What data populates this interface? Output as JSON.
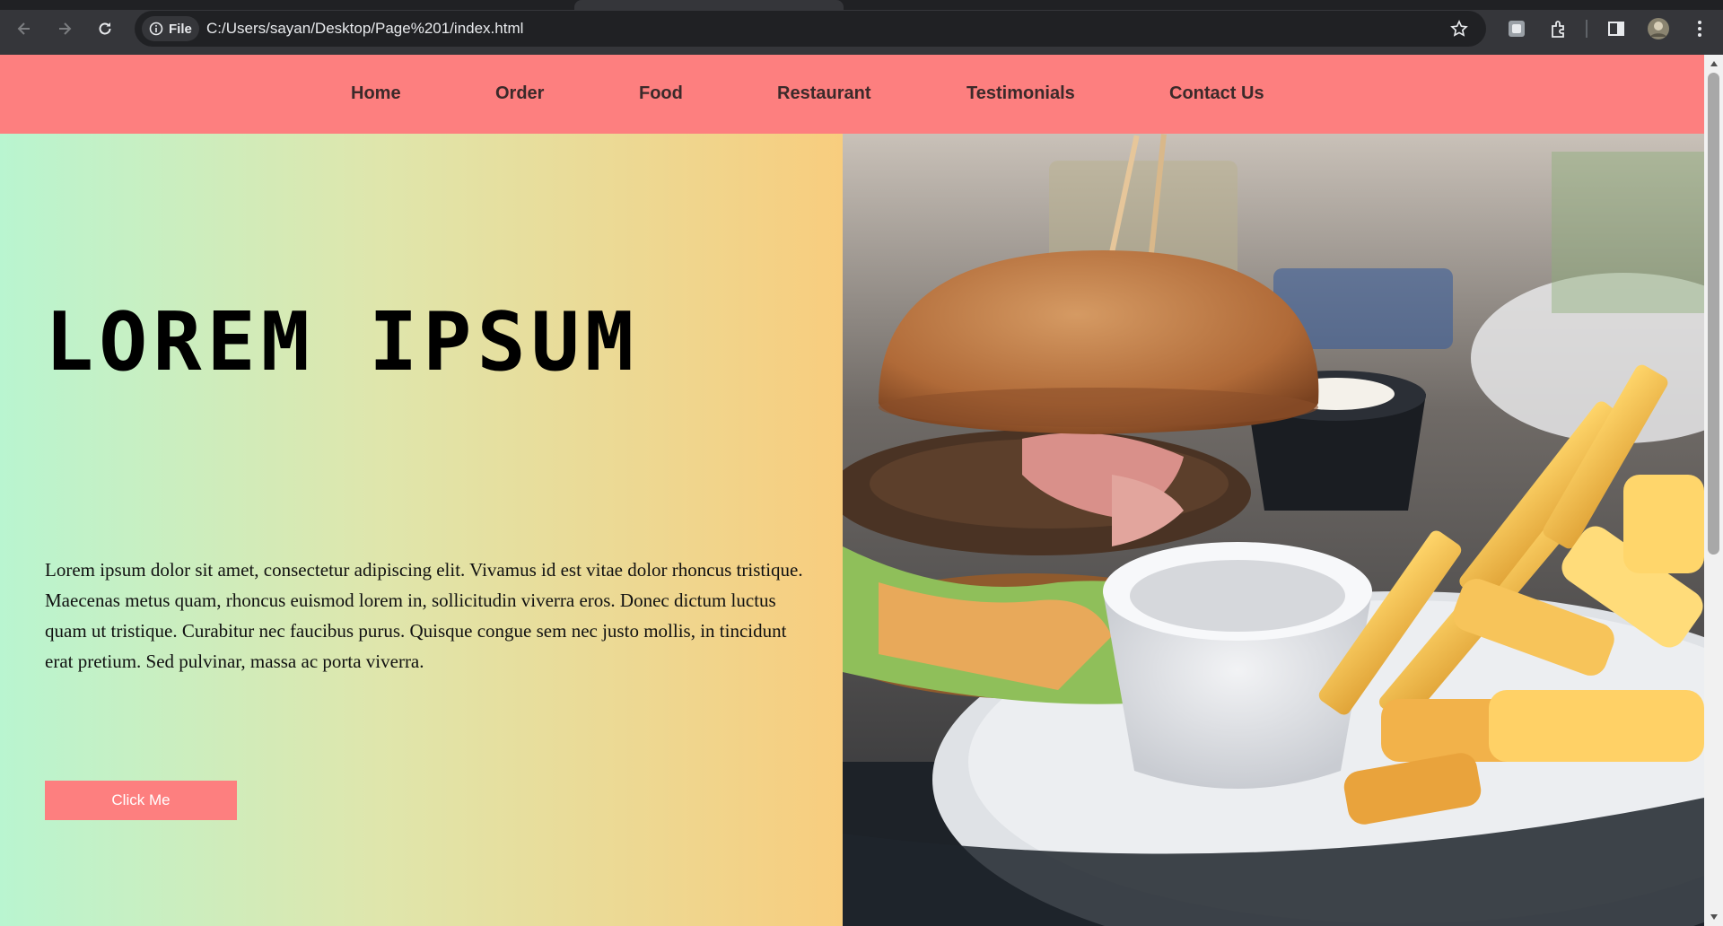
{
  "browser": {
    "file_chip": "File",
    "url": "C:/Users/sayan/Desktop/Page%201/index.html",
    "icons": [
      "back-arrow-icon",
      "forward-arrow-icon",
      "reload-icon",
      "info-icon",
      "star-icon",
      "extension-puzzle-icon",
      "side-panel-icon",
      "menu-dots-icon"
    ]
  },
  "nav": {
    "items": [
      "Home",
      "Order",
      "Food",
      "Restaurant",
      "Testimonials",
      "Contact Us"
    ],
    "background": "#fd7f7f"
  },
  "hero": {
    "title": "LOREM IPSUM",
    "body": "Lorem ipsum dolor sit amet, consectetur adipiscing elit. Vivamus id est vitae dolor rhoncus tristique. Maecenas metus quam, rhoncus euismod lorem in, sollicitudin viverra eros. Donec dictum luctus quam ut tristique. Curabitur nec faucibus purus. Quisque congue sem nec justo mollis, in tincidunt erat pretium. Sed pulvinar, massa ac porta viverra.",
    "button_label": "Click Me",
    "gradient": [
      "#b9f5d0",
      "#dfe6ac",
      "#f8cd7e"
    ],
    "button_color": "#fd7f7f"
  }
}
